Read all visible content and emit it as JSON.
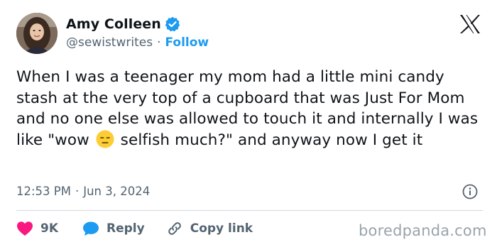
{
  "author": {
    "display_name": "Amy Colleen",
    "handle": "@sewistwrites",
    "separator": "·",
    "follow_label": "Follow",
    "verified": true,
    "verified_color": "#1d9bf0",
    "avatar_icon": "avatar-photo"
  },
  "tweet": {
    "text_before_emoji": "When I was a teenager my mom had a little mini candy stash at the very top of a cupboard that was Just For Mom and no one else was allowed to touch it and internally I was like \"wow ",
    "emoji": "expressionless-face-emoji",
    "text_after_emoji": " selfish much?\" and anyway now I get it"
  },
  "meta": {
    "time": "12:53 PM",
    "separator": "·",
    "date": "Jun 3, 2024"
  },
  "actions": {
    "likes_count": "9K",
    "reply_label": "Reply",
    "copy_link_label": "Copy link",
    "like_color": "#f91880",
    "reply_color": "#1d9bf0"
  },
  "brand": {
    "platform_logo": "x-logo",
    "watermark": "boredpanda.com"
  }
}
